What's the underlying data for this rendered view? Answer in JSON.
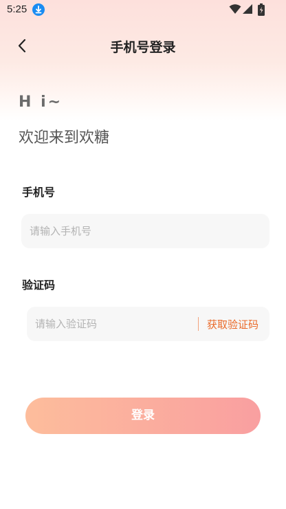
{
  "status_bar": {
    "time": "5:25",
    "download_icon": "download-badge-icon",
    "wifi_icon": "wifi-icon",
    "signal_icon": "cell-signal-icon",
    "battery_icon": "battery-icon"
  },
  "header": {
    "back_icon": "chevron-left-icon",
    "title": "手机号登录"
  },
  "greeting": {
    "hi": "H i~",
    "welcome": "欢迎来到欢糖"
  },
  "form": {
    "phone_label": "手机号",
    "phone_value": "",
    "phone_placeholder": "请输入手机号",
    "code_label": "验证码",
    "code_value": "",
    "code_placeholder": "请输入验证码",
    "get_code_label": "获取验证码"
  },
  "login_button": "登录",
  "colors": {
    "accent_orange": "#ea6a2a",
    "button_gradient_start": "#fdbd9c",
    "button_gradient_end": "#f99fa0",
    "download_badge": "#1a8cf2"
  }
}
